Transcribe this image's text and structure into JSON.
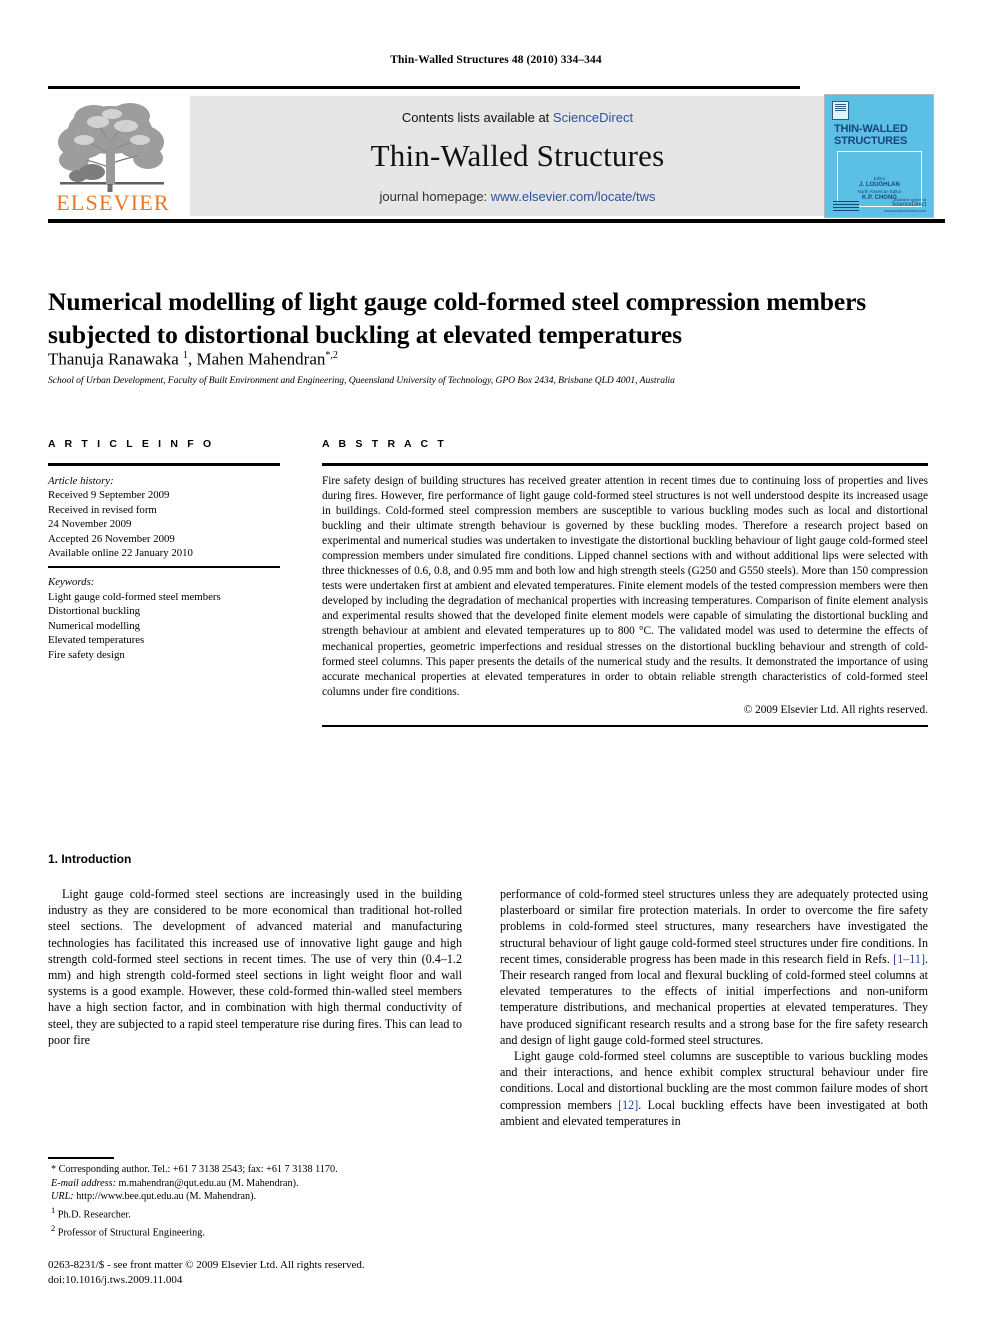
{
  "running_head": "Thin-Walled Structures 48 (2010) 334–344",
  "masthead": {
    "contents_prefix": "Contents lists available at ",
    "sciencedirect": "ScienceDirect",
    "journal_name": "Thin-Walled Structures",
    "homepage_prefix": "journal homepage: ",
    "homepage_url": "www.elsevier.com/locate/tws",
    "publisher": "ELSEVIER",
    "link_color": "#2b52a0",
    "publisher_color": "#E87722",
    "band_color": "#e6e6e6"
  },
  "cover": {
    "title_line1": "THIN-WALLED",
    "title_line2": "STRUCTURES",
    "editor_label": "Editor",
    "editor_name": "J. LOUGHLAN",
    "coeditor_label": "North American Editor",
    "coeditor_name": "K.P. CHONG",
    "footer_right_small": "Available online at",
    "footer_right_big": "ScienceDirect",
    "footer_right_url": "www.sciencedirect.com",
    "background_color": "#5bc0e4",
    "text_color": "#17467e"
  },
  "article": {
    "title": "Numerical modelling of light gauge cold-formed steel compression members subjected to distortional buckling at elevated temperatures",
    "authors_part1": "Thanuja Ranawaka ",
    "authors_sup1": "1",
    "authors_part2": ", Mahen Mahendran",
    "authors_sup2": "*,2",
    "affiliation": "School of Urban Development, Faculty of Built Environment and Engineering, Queensland University of Technology, GPO Box 2434, Brisbane QLD 4001, Australia"
  },
  "article_info": {
    "heading": "A R T I C L E  I N F O",
    "history_label": "Article history:",
    "history": [
      "Received 9 September 2009",
      "Received in revised form",
      "24 November 2009",
      "Accepted 26 November 2009",
      "Available online 22 January 2010"
    ],
    "keywords_label": "Keywords:",
    "keywords": [
      "Light gauge cold-formed steel members",
      "Distortional buckling",
      "Numerical modelling",
      "Elevated temperatures",
      "Fire safety design"
    ]
  },
  "abstract": {
    "heading": "A B S T R A C T",
    "text": "Fire safety design of building structures has received greater attention in recent times due to continuing loss of properties and lives during fires. However, fire performance of light gauge cold-formed steel structures is not well understood despite its increased usage in buildings. Cold-formed steel compression members are susceptible to various buckling modes such as local and distortional buckling and their ultimate strength behaviour is governed by these buckling modes. Therefore a research project based on experimental and numerical studies was undertaken to investigate the distortional buckling behaviour of light gauge cold-formed steel compression members under simulated fire conditions. Lipped channel sections with and without additional lips were selected with three thicknesses of 0.6, 0.8, and 0.95 mm and both low and high strength steels (G250 and G550 steels). More than 150 compression tests were undertaken first at ambient and elevated temperatures. Finite element models of the tested compression members were then developed by including the degradation of mechanical properties with increasing temperatures. Comparison of finite element analysis and experimental results showed that the developed finite element models were capable of simulating the distortional buckling and strength behaviour at ambient and elevated temperatures up to 800 °C. The validated model was used to determine the effects of mechanical properties, geometric imperfections and residual stresses on the distortional buckling behaviour and strength of cold-formed steel columns. This paper presents the details of the numerical study and the results. It demonstrated the importance of using accurate mechanical properties at elevated temperatures in order to obtain reliable strength characteristics of cold-formed steel columns under fire conditions.",
    "copyright": "© 2009 Elsevier Ltd. All rights reserved."
  },
  "body": {
    "section_heading": "1. Introduction",
    "left_paragraphs": [
      "Light gauge cold-formed steel sections are increasingly used in the building industry as they are considered to be more economical than traditional hot-rolled steel sections. The development of advanced material and manufacturing technologies has facilitated this increased use of innovative light gauge and high strength cold-formed steel sections in recent times. The use of very thin (0.4–1.2 mm) and high strength cold-formed steel sections in light weight floor and wall systems is a good example. However, these cold-formed thin-walled steel members have a high section factor, and in combination with high thermal conductivity of steel, they are subjected to a rapid steel temperature rise during fires. This can lead to poor fire"
    ],
    "right_para_1a": "performance of cold-formed steel structures unless they are adequately protected using plasterboard or similar fire protection materials. In order to overcome the fire safety problems in cold-formed steel structures, many researchers have investigated the structural behaviour of light gauge cold-formed steel structures under fire conditions. In recent times, considerable progress has been made in this research field in Refs. ",
    "right_ref_1": "[1–11]",
    "right_para_1b": ". Their research ranged from local and flexural buckling of cold-formed steel columns at elevated temperatures to the effects of initial imperfections and non-uniform temperature distributions, and mechanical properties at elevated temperatures. They have produced significant research results and a strong base for the fire safety research and design of light gauge cold-formed steel structures.",
    "right_para_2a": "Light gauge cold-formed steel columns are susceptible to various buckling modes and their interactions, and hence exhibit complex structural behaviour under fire conditions. Local and distortional buckling are the most common failure modes of short compression members ",
    "right_ref_2": "[12]",
    "right_para_2b": ". Local buckling effects have been investigated at both ambient and elevated temperatures in"
  },
  "footnotes": {
    "corresponding": "* Corresponding author. Tel.: +61 7 3138 2543; fax: +61 7 3138 1170.",
    "email_label": "E-mail address:",
    "email_value": " m.mahendran@qut.edu.au (M. Mahendran).",
    "url_label": "URL:",
    "url_value": " http://www.bee.qut.edu.au (M. Mahendran).",
    "note1_sup": "1",
    "note1": " Ph.D. Researcher.",
    "note2_sup": "2",
    "note2": " Professor of Structural Engineering."
  },
  "imprint": {
    "line1": "0263-8231/$ - see front matter © 2009 Elsevier Ltd. All rights reserved.",
    "line2": "doi:10.1016/j.tws.2009.11.004"
  }
}
